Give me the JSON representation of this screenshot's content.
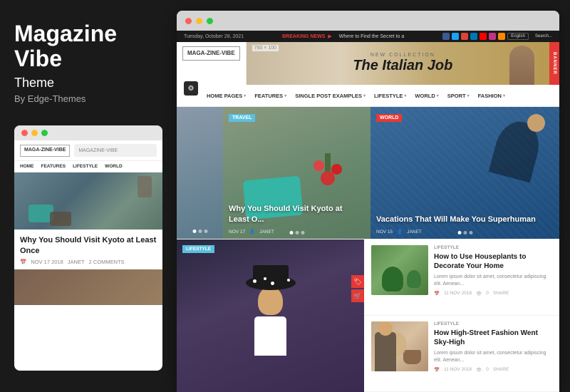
{
  "sidebar": {
    "title": "Magazine\nVibe",
    "title_line1": "Magazine",
    "title_line2": "Vibe",
    "subtitle": "Theme",
    "by": "By Edge-Themes",
    "mini_browser": {
      "logo": "MAGA-ZINE-VIBE",
      "search_text": "MAGAZINE-VIBE",
      "article_title": "Why You Should Visit Kyoto at Least Once",
      "meta_date": "NOV 17 2018",
      "meta_author": "JANET",
      "meta_comments": "2 COMMENTS"
    }
  },
  "browser": {
    "top_bar": {
      "date": "Tuesday, October 28, 2021",
      "breaking_label": "BREAKING NEWS",
      "breaking_text": "Where to Find the Secret to a",
      "lang": "English",
      "search": "Search..."
    },
    "logo": "MAGA-ZINE-VIBE",
    "banner": {
      "size_label": "760 × 100",
      "title": "The Italian Job",
      "subtitle": "NEW COLLECTION"
    },
    "nav_items": [
      "HOME PAGES",
      "FEATURES",
      "SINGLE POST EXAMPLES",
      "LIFESTYLE",
      "WORLD",
      "SPORT",
      "FASHION"
    ],
    "hero": {
      "center": {
        "badge": "TRAVEL",
        "title": "Why You Should Visit Kyoto at Least O...",
        "meta_date": "NOV 17",
        "meta_author": "JANET"
      },
      "right": {
        "badge": "WORLD",
        "title": "Vacations That Will Make You Superhuman",
        "meta_date": "NOV 15",
        "meta_author": "JANET"
      }
    },
    "bottom": {
      "left_badge": "LIFESTYLE",
      "articles": [
        {
          "category": "LIFESTYLE",
          "title": "How to Use Houseplants to Decorate Your Home",
          "excerpt": "Lorem ipsum dolor sit amet, consectetur adipiscing elit. Aenean...",
          "date": "11 NOV 2018",
          "views": "0",
          "comments": "SHARE"
        },
        {
          "category": "LIFESTYLE",
          "title": "How High-Street Fashion Went Sky-High",
          "excerpt": "Lorem ipsum dolor sit amet, consectetur adipiscing elit. Aenean...",
          "date": "11 NOV 2018",
          "views": "0",
          "comments": "SHARE"
        }
      ]
    }
  },
  "colors": {
    "accent_blue": "#5bc0de",
    "accent_red": "#e53935",
    "text_dark": "#1a1a1a",
    "text_gray": "#888888"
  },
  "icons": {
    "dots": "●●●",
    "menu": "☰",
    "settings": "⚙",
    "search": "🔍",
    "calendar": "📅",
    "user": "👤",
    "comment": "💬",
    "cart": "🛒",
    "tag": "🏷"
  }
}
